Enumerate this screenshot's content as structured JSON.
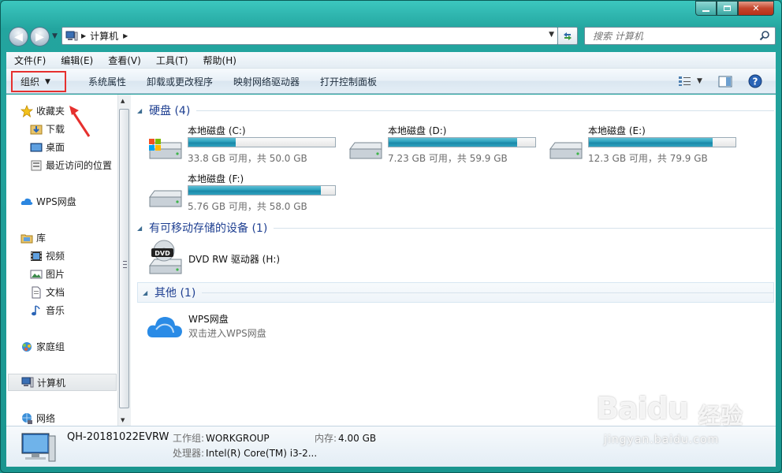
{
  "window": {
    "colors": {
      "frame": "#1b9c96",
      "group_title": "#1e3f91",
      "highlight": "#e6302e",
      "progress": "#2aa0bd"
    }
  },
  "address_bar": {
    "crumbs": [
      "计算机"
    ],
    "search_placeholder": "搜索 计算机"
  },
  "menu_bar": {
    "items": [
      "文件(F)",
      "编辑(E)",
      "查看(V)",
      "工具(T)",
      "帮助(H)"
    ]
  },
  "command_bar": {
    "organize": "组织",
    "commands": [
      "系统属性",
      "卸载或更改程序",
      "映射网络驱动器",
      "打开控制面板"
    ]
  },
  "nav_pane": {
    "favorites": {
      "label": "收藏夹",
      "children": [
        "下载",
        "桌面",
        "最近访问的位置"
      ]
    },
    "wps": "WPS网盘",
    "libraries": {
      "label": "库",
      "children": [
        "视频",
        "图片",
        "文档",
        "音乐"
      ]
    },
    "homegroup": "家庭组",
    "computer": "计算机",
    "network": "网络"
  },
  "content": {
    "groups": {
      "hard_disks": "硬盘 (4)",
      "removable": "有可移动存储的设备 (1)",
      "other": "其他 (1)"
    },
    "drives": [
      {
        "name": "本地磁盘 (C:)",
        "free_text": "33.8 GB 可用，共 50.0 GB",
        "used_fraction": 0.324
      },
      {
        "name": "本地磁盘 (D:)",
        "free_text": "7.23 GB 可用，共 59.9 GB",
        "used_fraction": 0.879
      },
      {
        "name": "本地磁盘 (E:)",
        "free_text": "12.3 GB 可用，共 79.9 GB",
        "used_fraction": 0.846
      },
      {
        "name": "本地磁盘 (F:)",
        "free_text": "5.76 GB 可用，共 58.0 GB",
        "used_fraction": 0.901
      }
    ],
    "dvd": {
      "name": "DVD RW 驱动器 (H:)",
      "badge": "DVD"
    },
    "wps": {
      "name": "WPS网盘",
      "subtitle": "双击进入WPS网盘"
    }
  },
  "details_pane": {
    "computer_name": "QH-20181022EVRW",
    "workgroup_label": "工作组:",
    "workgroup_value": "WORKGROUP",
    "memory_label": "内存:",
    "memory_value": "4.00 GB",
    "cpu_label": "处理器:",
    "cpu_value": "Intel(R) Core(TM) i3-2..."
  },
  "watermark": {
    "logo": "Baidu",
    "cn": "经验",
    "url": "jingyan.baidu.com"
  }
}
